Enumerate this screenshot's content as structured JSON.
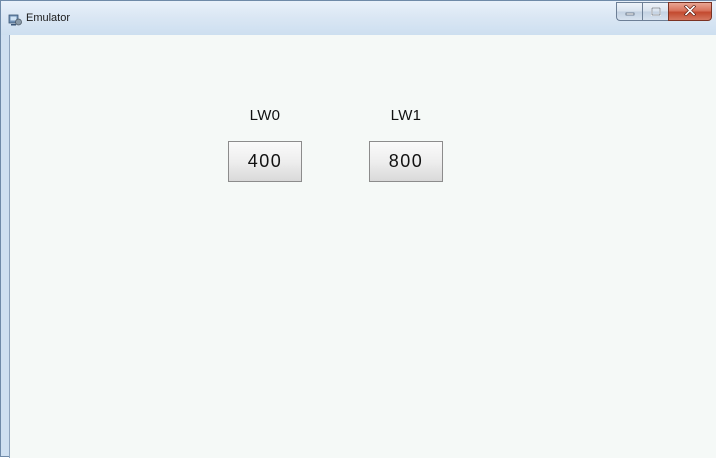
{
  "window": {
    "title": "Emulator",
    "icon": "emulator-icon",
    "controls": {
      "minimize": "minimize-icon",
      "maximize": "maximize-icon",
      "close": "close-icon"
    }
  },
  "variables": [
    {
      "label": "LW0",
      "value": "400"
    },
    {
      "label": "LW1",
      "value": "800"
    }
  ],
  "colors": {
    "client_background": "#f5f9f7",
    "close_button": "#c9533a"
  }
}
